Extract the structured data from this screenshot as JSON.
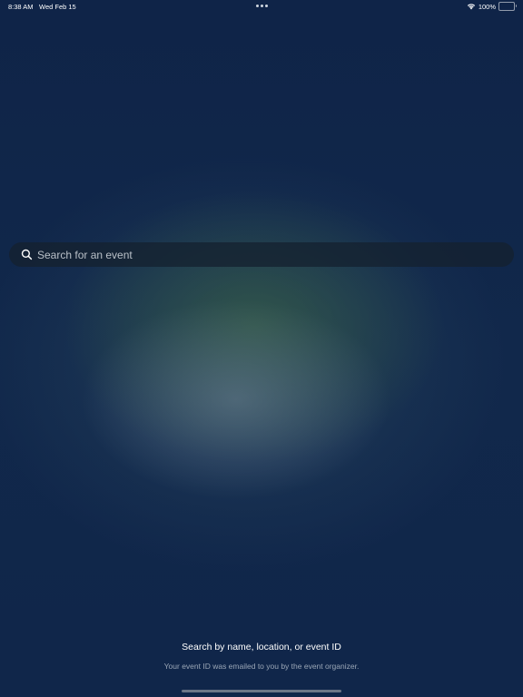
{
  "status_bar": {
    "time": "8:38 AM",
    "date": "Wed Feb 15",
    "battery": "100%",
    "battery_level": 1.0,
    "icons": [
      "multitasking-dots-icon",
      "wifi-icon",
      "battery-icon"
    ]
  },
  "search": {
    "placeholder": "Search for an event",
    "value": "",
    "icon": "search-icon"
  },
  "hint": {
    "title": "Search by name, location, or event ID",
    "subtitle": "Your event ID was emailed to you by the event organizer."
  },
  "colors": {
    "background": "#10264a",
    "search_bg": "#142130",
    "placeholder": "#b9c0c8",
    "subtitle": "#9aa6b6"
  }
}
